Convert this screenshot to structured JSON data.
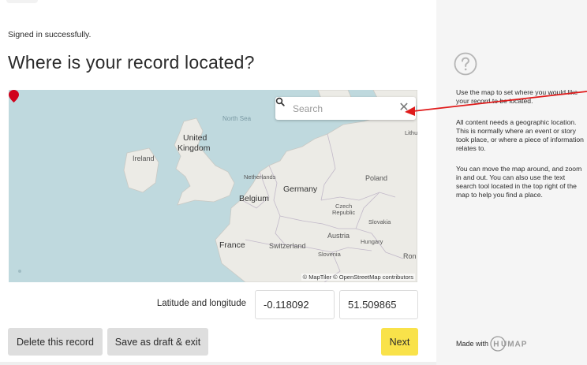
{
  "status": {
    "flash_message": "Signed in successfully."
  },
  "page": {
    "title": "Where is your record located?"
  },
  "map": {
    "search": {
      "placeholder": "Search"
    },
    "labels": {
      "north_sea": "North Sea",
      "united": "United",
      "kingdom": "Kingdom",
      "ireland": "Ireland",
      "netherlands": "Netherlands",
      "germany": "Germany",
      "belgium": "Belgium",
      "poland": "Poland",
      "czech": "Czech",
      "republic": "Republic",
      "slovakia": "Slovakia",
      "austria": "Austria",
      "hungary": "Hungary",
      "switzerland": "Switzerland",
      "slovenia": "Slovenia",
      "france": "France",
      "ron": "Ron",
      "lith": "Lithu"
    },
    "attribution": "© MapTiler © OpenStreetMap contributors",
    "marker_color": "#d0021b",
    "water_color": "#bfd9de",
    "land_color": "#ecebe6"
  },
  "location": {
    "label": "Latitude and longitude",
    "latitude": "-0.118092",
    "longitude": "51.509865"
  },
  "actions": {
    "delete_label": "Delete this record",
    "draft_label": "Save as draft & exit",
    "next_label": "Next",
    "next_color": "#f9e24a"
  },
  "help": {
    "icon": "question-circle-icon",
    "paragraphs": [
      "Use the map to set where you would like your record to be located.",
      "All content needs a geographic location. This is normally where an event or story took place, or where a piece of information relates to.",
      "You can move the map around, and zoom in and out. You can also use the text search tool located in the top right of the map to help you find a place."
    ]
  },
  "footer": {
    "made_with": "Made with",
    "brand": "HUMAP"
  }
}
